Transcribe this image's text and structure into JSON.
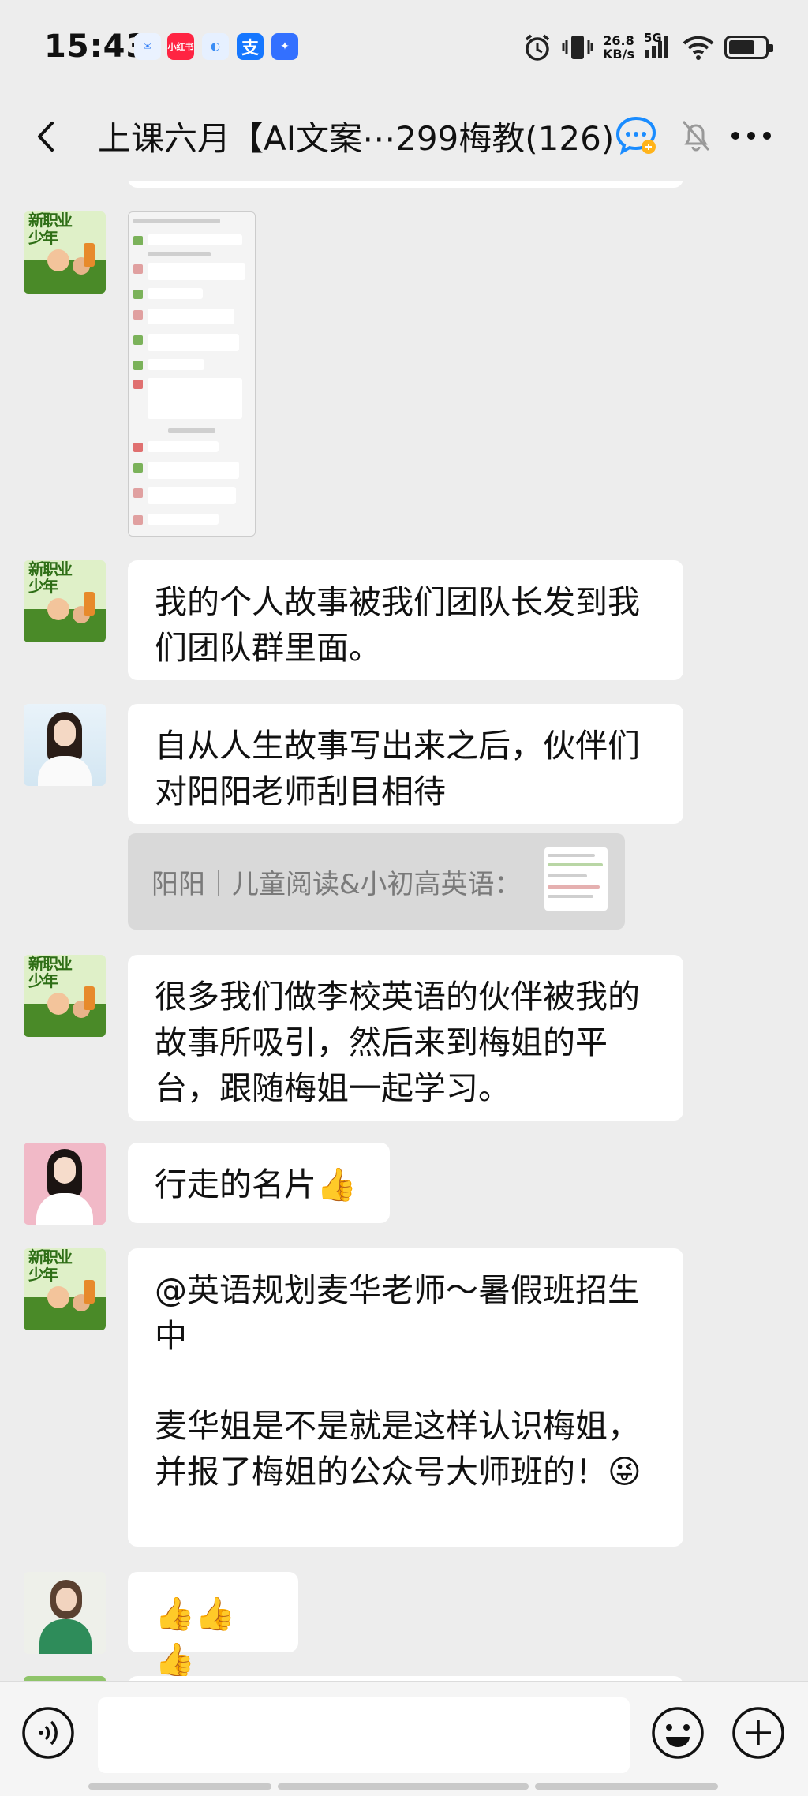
{
  "status_bar": {
    "time": "15:43",
    "apps": [
      {
        "name": "message-app-icon",
        "color": "#2f7cf6",
        "glyph": "✉"
      },
      {
        "name": "xiaohongshu-icon",
        "color": "#ff2442",
        "glyph": "小红书"
      },
      {
        "name": "docs-app-icon",
        "color": "#3a8df5",
        "glyph": "◐"
      },
      {
        "name": "alipay-icon",
        "color": "#1677ff",
        "glyph": "支"
      },
      {
        "name": "lark-app-icon",
        "color": "#3370ff",
        "glyph": "✦"
      }
    ],
    "net_speed_value": "26.8",
    "net_speed_unit": "KB/s",
    "network_type": "5G"
  },
  "header": {
    "title": "上课六月【AI文案⋯299梅教(126)"
  },
  "messages": [
    {
      "id": "m1",
      "type": "image",
      "avatar": "cartoon"
    },
    {
      "id": "m2",
      "type": "text",
      "avatar": "cartoon",
      "text": "我的个人故事被我们团队长发到我们团队群里面。"
    },
    {
      "id": "m3",
      "type": "text",
      "avatar": "woman1",
      "text": "自从人生故事写出来之后，伙伴们对阳阳老师刮目相待",
      "quote": "阳阳｜儿童阅读&小初高英语："
    },
    {
      "id": "m4",
      "type": "text",
      "avatar": "cartoon",
      "text": "很多我们做李校英语的伙伴被我的故事所吸引，然后来到梅姐的平台，跟随梅姐一起学习。"
    },
    {
      "id": "m5",
      "type": "text",
      "avatar": "woman2",
      "text": "行走的名片👍"
    },
    {
      "id": "m6",
      "type": "text",
      "avatar": "cartoon",
      "text_lines": [
        "@英语规划麦华老师～暑假班招生中",
        "",
        "麦华姐是不是就是这样认识梅姐，并报了梅姐的公众号大师班的！😜"
      ]
    },
    {
      "id": "m7",
      "type": "text",
      "avatar": "woman3",
      "text": "👍👍👍"
    }
  ],
  "avatar_texts": {
    "cartoon": "新职业少年"
  }
}
